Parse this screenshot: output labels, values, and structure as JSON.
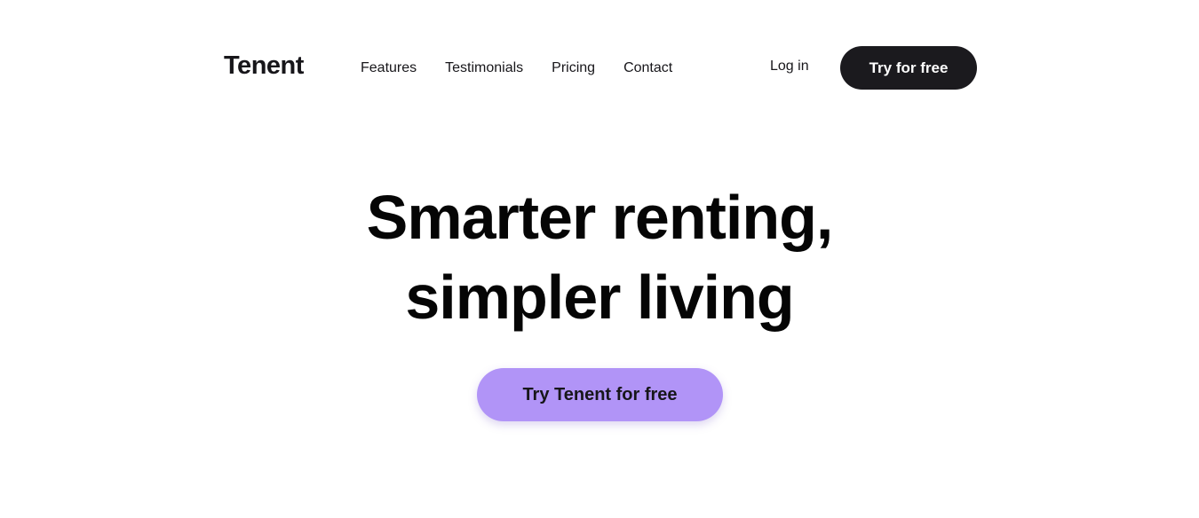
{
  "brand": {
    "name": "Tenent"
  },
  "nav": {
    "links": [
      {
        "label": "Features"
      },
      {
        "label": "Testimonials"
      },
      {
        "label": "Pricing"
      },
      {
        "label": "Contact"
      }
    ],
    "login_label": "Log in",
    "cta_label": "Try for free"
  },
  "hero": {
    "title_line1": "Smarter renting,",
    "title_line2": "simpler living",
    "cta_label": "Try Tenent for free"
  },
  "colors": {
    "primary_dark": "#1b1a1e",
    "accent_purple": "#b194f7",
    "background": "#ffffff"
  }
}
